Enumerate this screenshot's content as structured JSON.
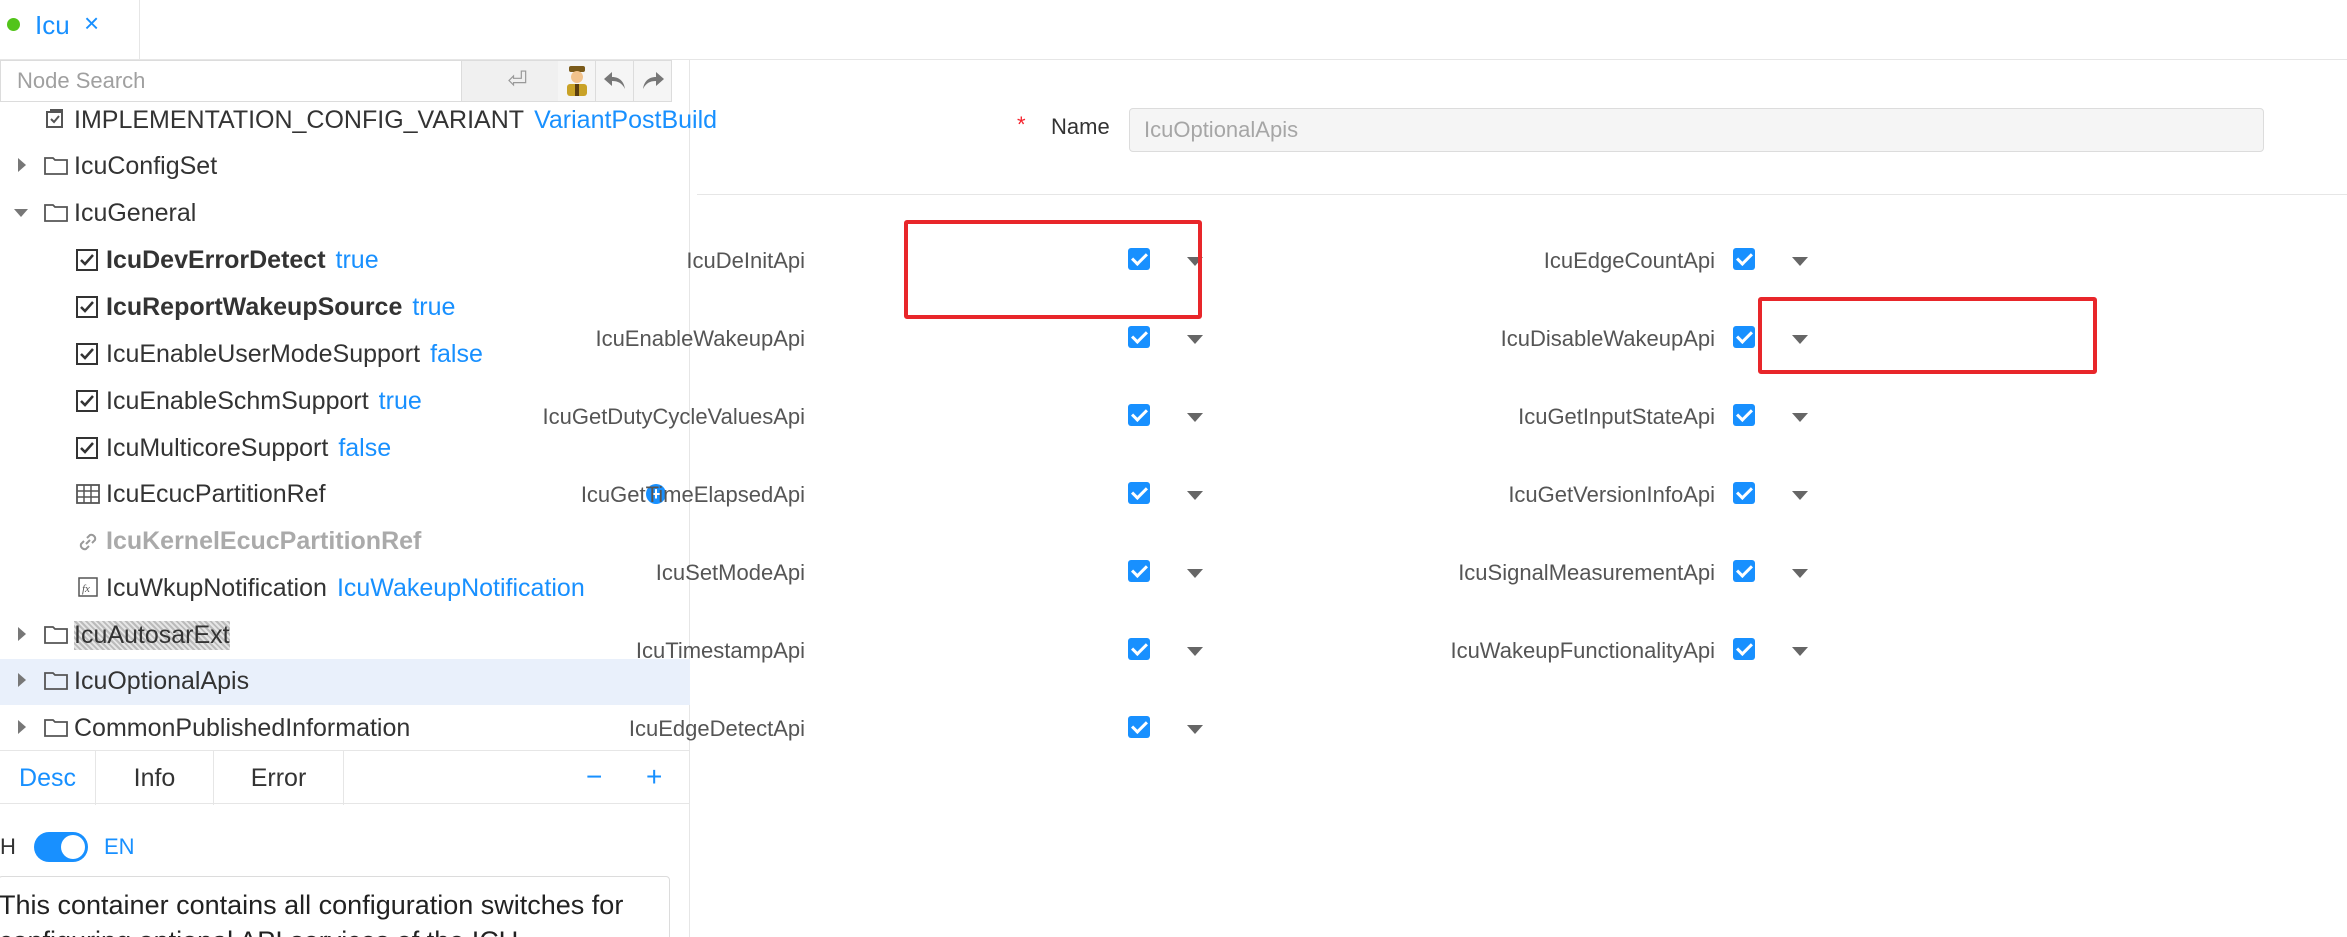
{
  "tab": {
    "label": "Icu",
    "close": "×"
  },
  "search": {
    "placeholder": "Node Search",
    "enter": "⏎"
  },
  "tree": {
    "rows": [
      {
        "label": "IMPLEMENTATION_CONFIG_VARIANT",
        "value": "VariantPostBuild"
      },
      {
        "label": "IcuConfigSet"
      },
      {
        "label": "IcuGeneral"
      },
      {
        "label": "IcuDevErrorDetect",
        "value": "true"
      },
      {
        "label": "IcuReportWakeupSource",
        "value": "true"
      },
      {
        "label": "IcuEnableUserModeSupport",
        "value": "false"
      },
      {
        "label": "IcuEnableSchmSupport",
        "value": "true"
      },
      {
        "label": "IcuMulticoreSupport",
        "value": "false"
      },
      {
        "label": "IcuEcucPartitionRef"
      },
      {
        "label": "IcuKernelEcucPartitionRef"
      },
      {
        "label": "IcuWkupNotification",
        "value": "IcuWakeupNotification"
      },
      {
        "label": "IcuAutosarExt"
      },
      {
        "label": "IcuOptionalApis"
      },
      {
        "label": "CommonPublishedInformation"
      }
    ]
  },
  "bottom_tabs": {
    "desc": "Desc",
    "info": "Info",
    "error": "Error",
    "minus": "−",
    "plus": "+"
  },
  "lang": {
    "left": "H",
    "right": "EN"
  },
  "description": "This container contains all configuration switches for configuring optional API services of the ICU",
  "form": {
    "name_required": "*",
    "name_label": "Name",
    "name_value": "IcuOptionalApis",
    "left_fields": [
      "IcuDeInitApi",
      "IcuEnableWakeupApi",
      "IcuGetDutyCycleValuesApi",
      "IcuGetTimeElapsedApi",
      "IcuSetModeApi",
      "IcuTimestampApi",
      "IcuEdgeDetectApi"
    ],
    "right_fields": [
      "IcuEdgeCountApi",
      "IcuDisableWakeupApi",
      "IcuGetInputStateApi",
      "IcuGetVersionInfoApi",
      "IcuSignalMeasurementApi",
      "IcuWakeupFunctionalityApi"
    ],
    "checked": true
  },
  "colors": {
    "accent": "#1890ff",
    "highlight": "#e8262a",
    "status_dot": "#52c41a"
  }
}
